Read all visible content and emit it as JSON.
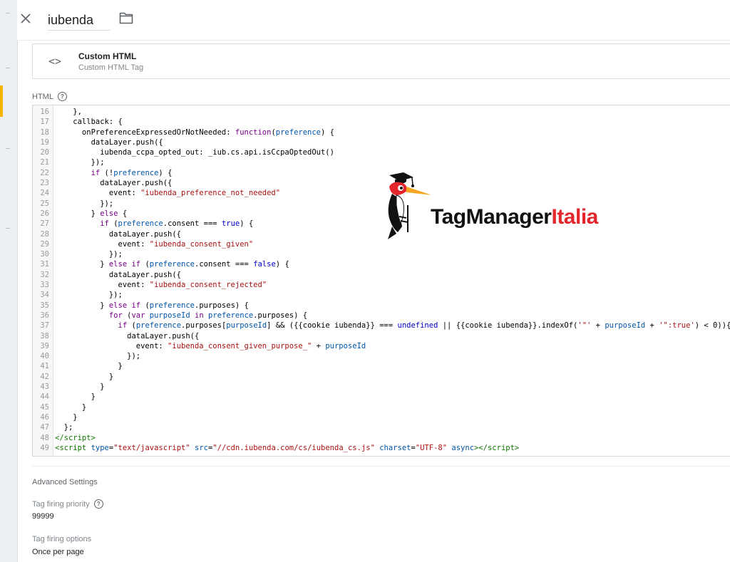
{
  "header": {
    "tag_name": "iubenda"
  },
  "tag_type": {
    "title": "Custom HTML",
    "subtitle": "Custom HTML Tag"
  },
  "html_section": {
    "label": "HTML"
  },
  "code": {
    "lines": [
      {
        "n": "16",
        "html": "    },"
      },
      {
        "n": "17",
        "html": "    callback: {"
      },
      {
        "n": "18",
        "html": "      onPreferenceExpressedOrNotNeeded: <span class=\"kw\">function</span>(<span class=\"vr\">preference</span>) {"
      },
      {
        "n": "19",
        "html": "        dataLayer.push({"
      },
      {
        "n": "20",
        "html": "          iubenda_ccpa_opted_out: _iub.cs.api.isCcpaOptedOut()"
      },
      {
        "n": "21",
        "html": "        });"
      },
      {
        "n": "22",
        "html": "        <span class=\"kw\">if</span> (!<span class=\"vr\">preference</span>) {"
      },
      {
        "n": "23",
        "html": "          dataLayer.push({"
      },
      {
        "n": "24",
        "html": "            event: <span class=\"st\">\"iubenda_preference_not_needed\"</span>"
      },
      {
        "n": "25",
        "html": "          });"
      },
      {
        "n": "26",
        "html": "        } <span class=\"kw\">else</span> {"
      },
      {
        "n": "27",
        "html": "          <span class=\"kw\">if</span> (<span class=\"vr\">preference</span>.consent === <span class=\"at\">true</span>) {"
      },
      {
        "n": "28",
        "html": "            dataLayer.push({"
      },
      {
        "n": "29",
        "html": "              event: <span class=\"st\">\"iubenda_consent_given\"</span>"
      },
      {
        "n": "30",
        "html": "            });"
      },
      {
        "n": "31",
        "html": "          } <span class=\"kw\">else if</span> (<span class=\"vr\">preference</span>.consent === <span class=\"at\">false</span>) {"
      },
      {
        "n": "32",
        "html": "            dataLayer.push({"
      },
      {
        "n": "33",
        "html": "              event: <span class=\"st\">\"iubenda_consent_rejected\"</span>"
      },
      {
        "n": "34",
        "html": "            });"
      },
      {
        "n": "35",
        "html": "          } <span class=\"kw\">else if</span> (<span class=\"vr\">preference</span>.purposes) {"
      },
      {
        "n": "36",
        "html": "            <span class=\"kw\">for</span> (<span class=\"kw\">var</span> <span class=\"vr\">purposeId</span> <span class=\"kw\">in</span> <span class=\"vr\">preference</span>.purposes) {"
      },
      {
        "n": "37",
        "html": "              <span class=\"kw\">if</span> (<span class=\"vr\">preference</span>.purposes[<span class=\"vr\">purposeId</span>] &amp;&amp; ({{cookie iubenda}} === <span class=\"at\">undefined</span> || {{cookie iubenda}}.indexOf(<span class=\"st\">'\"'</span> + <span class=\"vr\">purposeId</span> + <span class=\"st\">'\":true'</span>) &lt; 0)){"
      },
      {
        "n": "38",
        "html": "                dataLayer.push({"
      },
      {
        "n": "39",
        "html": "                  event: <span class=\"st\">\"iubenda_consent_given_purpose_\"</span> + <span class=\"vr\">purposeId</span>"
      },
      {
        "n": "40",
        "html": "                });"
      },
      {
        "n": "41",
        "html": "              }"
      },
      {
        "n": "42",
        "html": "            }"
      },
      {
        "n": "43",
        "html": "          }"
      },
      {
        "n": "44",
        "html": "        }"
      },
      {
        "n": "45",
        "html": "      }"
      },
      {
        "n": "46",
        "html": "    }"
      },
      {
        "n": "47",
        "html": "  };"
      },
      {
        "n": "48",
        "html": "<span class=\"tg\">&lt;/script&gt;</span>"
      },
      {
        "n": "49",
        "html": "<span class=\"tg\">&lt;script</span> <span class=\"vr\">type</span>=<span class=\"st\">\"text/javascript\"</span> <span class=\"vr\">src</span>=<span class=\"st\">\"//cdn.iubenda.com/cs/iubenda_cs.js\"</span> <span class=\"vr\">charset</span>=<span class=\"st\">\"UTF-8\"</span> <span class=\"vr\">async</span><span class=\"tg\">&gt;&lt;/script&gt;</span>"
      }
    ]
  },
  "logo": {
    "part1": "TagManager",
    "part2": "Italia",
    "colors": {
      "dark": "#111111",
      "red": "#e3262c"
    }
  },
  "advanced": {
    "title": "Advanced Settings",
    "priority_label": "Tag firing priority",
    "priority_value": "99999",
    "options_label": "Tag firing options",
    "options_value": "Once per page"
  },
  "icons": {
    "close": "close-icon",
    "folder": "folder-icon",
    "code": "code-icon",
    "help": "help-icon"
  }
}
